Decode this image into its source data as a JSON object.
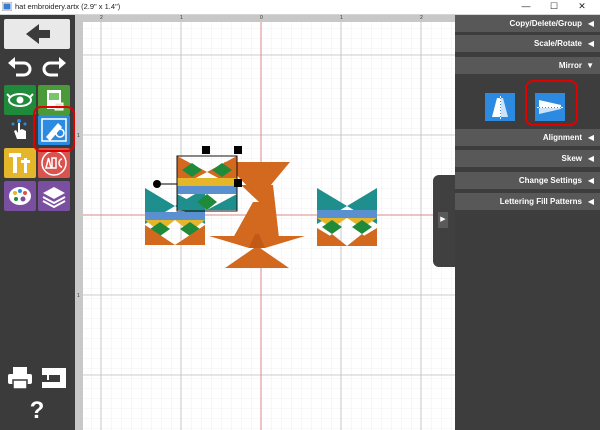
{
  "window": {
    "title": "hat embroidery.artx (2.9\" x 1.4\")",
    "controls": {
      "minimize": "—",
      "maximize": "☐",
      "close": "✕"
    }
  },
  "toolbar": {
    "buttons": [
      {
        "name": "back-arrow-icon"
      },
      {
        "name": "undo-icon"
      },
      {
        "name": "redo-icon"
      },
      {
        "name": "view-eye-icon"
      },
      {
        "name": "design-page-icon"
      },
      {
        "name": "select-hand-icon"
      },
      {
        "name": "transform-icon"
      },
      {
        "name": "text-tt-icon"
      },
      {
        "name": "monogram-abc-icon"
      },
      {
        "name": "palette-icon"
      },
      {
        "name": "layers-icon"
      },
      {
        "name": "print-icon"
      },
      {
        "name": "embroidery-machine-icon"
      },
      {
        "name": "help-icon"
      }
    ],
    "help_label": "?"
  },
  "rulers": {
    "top": [
      "2",
      "1",
      "0",
      "1",
      "2"
    ],
    "left": [
      "1",
      "1"
    ]
  },
  "panel": {
    "sections": [
      {
        "label": "Copy/Delete/Group",
        "arrow": "◀"
      },
      {
        "label": "Scale/Rotate",
        "arrow": "◀"
      },
      {
        "label": "Mirror",
        "arrow": "▼"
      },
      {
        "label": "Alignment",
        "arrow": "◀"
      },
      {
        "label": "Skew",
        "arrow": "◀"
      },
      {
        "label": "Change Settings",
        "arrow": "◀"
      },
      {
        "label": "Lettering Fill Patterns",
        "arrow": "◀"
      }
    ],
    "side_tab_arrow": "▶"
  },
  "colors": {
    "orange": "#d2691e",
    "teal": "#1e8f8c",
    "green": "#1f8a3a",
    "yellow": "#e6b62a",
    "blue": "#5a8fd0",
    "accent_blue": "#2c8be0",
    "highlight_red": "#e00000"
  }
}
